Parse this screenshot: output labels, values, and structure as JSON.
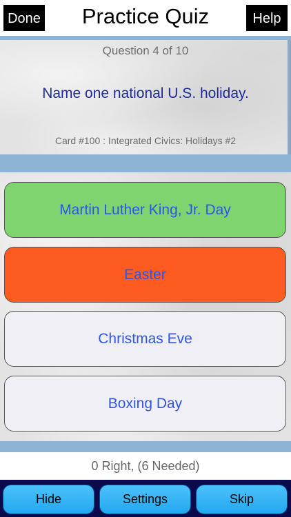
{
  "header": {
    "done_label": "Done",
    "title": "Practice Quiz",
    "help_label": "Help"
  },
  "question": {
    "counter": "Question 4 of 10",
    "text": "Name one national U.S. holiday.",
    "card": "Card #100 : Integrated Civics: Holidays #2"
  },
  "answers": [
    {
      "label": "Martin Luther King, Jr. Day",
      "state": "correct",
      "color": "#7fd46f"
    },
    {
      "label": "Easter",
      "state": "incorrect",
      "color": "#fd5b1f"
    },
    {
      "label": "Christmas Eve",
      "state": "default",
      "color": "#f0eff6"
    },
    {
      "label": "Boxing Day",
      "state": "default",
      "color": "#f0eff6"
    }
  ],
  "score": "0 Right, (6 Needed)",
  "toolbar": {
    "hide_label": "Hide",
    "settings_label": "Settings",
    "skip_label": "Skip"
  },
  "colors": {
    "accent_blue": "#2f55e4",
    "question_text": "#1f2a9e",
    "toolbar_bg": "#0a0a4c",
    "stripe": "#8db4d4"
  }
}
